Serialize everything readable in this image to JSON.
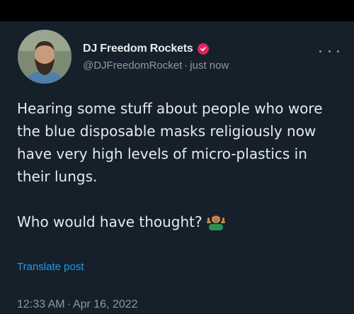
{
  "author": {
    "display_name": "DJ Freedom Rockets",
    "handle": "@DJFreedomRocket",
    "separator": "·",
    "time_ago": "just now",
    "verified_color": "#e0245e"
  },
  "tweet": {
    "paragraph_1": "Hearing some stuff about people who wore the blue disposable masks religiously now have very high levels of micro-plastics in their lungs.",
    "paragraph_2": "Who would have thought?",
    "emoji": "person-shrugging-emoji"
  },
  "translate_label": "Translate post",
  "timestamp": {
    "time": "12:33 AM",
    "separator": "·",
    "date": "Apr 16, 2022"
  },
  "icons": {
    "more": "more-horizontal-icon",
    "verified": "verified-badge-icon"
  },
  "colors": {
    "background": "#15202b",
    "text": "#e7e9ea",
    "secondary_text": "#8b98a5",
    "link": "#1d9bf0"
  }
}
